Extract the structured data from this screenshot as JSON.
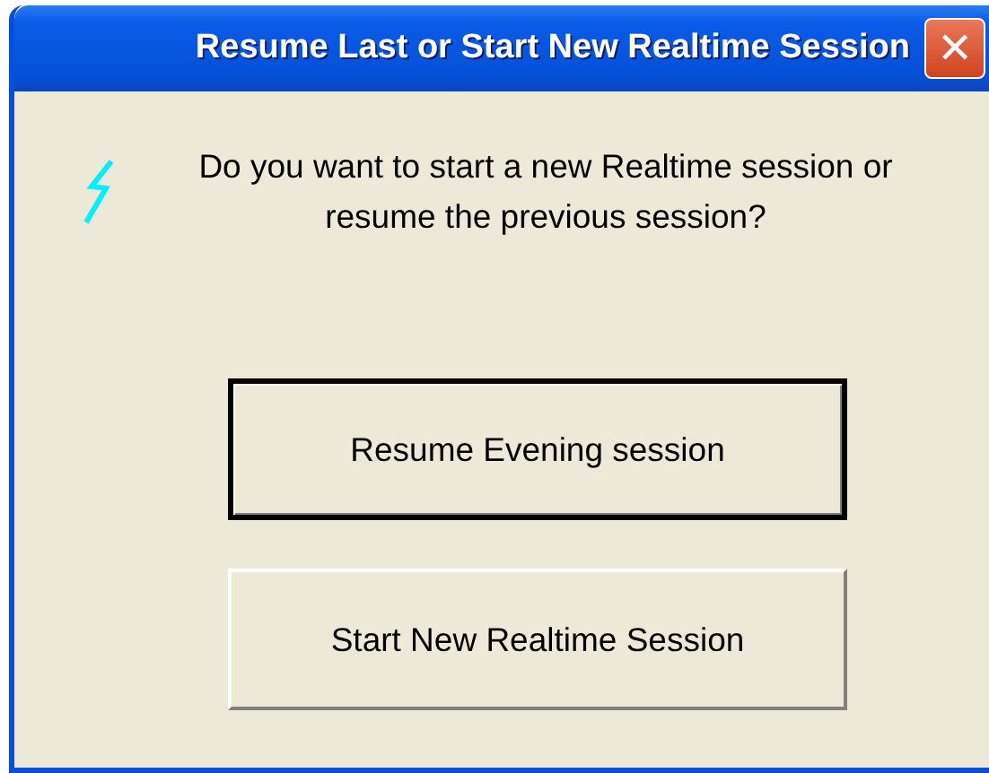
{
  "window": {
    "title": "Resume Last or Start New Realtime Session",
    "close_glyph": "✕"
  },
  "message": "Do you want to start a new Realtime session or resume the previous session?",
  "buttons": [
    {
      "label": "Resume Evening session",
      "default": true
    },
    {
      "label": "Start New Realtime Session",
      "default": false
    }
  ]
}
